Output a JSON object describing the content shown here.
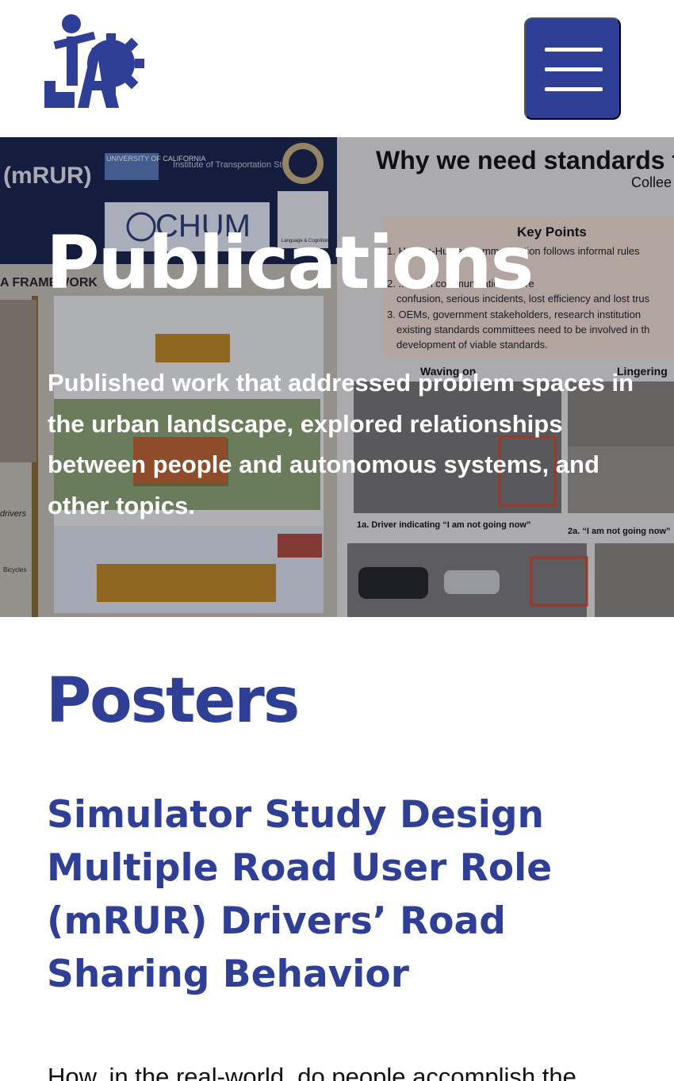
{
  "header": {
    "logo_name": "jap-logo",
    "menu_icon": "hamburger-menu-icon",
    "brand_color": "#2f3f96"
  },
  "hero": {
    "title": "Publications",
    "subtitle": "Published work that addressed problem spaces in the urban landscape, explored relationships between people and autonomous systems, and other topics.",
    "background": {
      "left_poster": {
        "tag": "(mRUR)",
        "univ": "UNIVERSITY OF CALIFORNIA",
        "institute": "Institute of Transportation Studies",
        "chum": "CHUM",
        "lab": "Language & Cognition Lab",
        "framework": "A FRAMEWORK",
        "drivers": "drivers",
        "bicycles": "Bicycles"
      },
      "right_poster": {
        "headline": "Why we need standards f",
        "author": "Collee",
        "key_points_title": "Key Points",
        "points": [
          "1. Human-Human communication follows informal rules",
          "2. ...uman communication will re",
          "confusion, serious incidents, lost efficiency and lost trus",
          "3. OEMs, government stakeholders, research institution",
          "existing standards committees need to be involved in th",
          "development of viable standards."
        ],
        "waving": "Waving on",
        "lingering": "Lingering",
        "caption_1a": "1a. Driver indicating “I am not going now”",
        "caption_2a": "2a. “I am not going now”"
      }
    }
  },
  "content": {
    "section_title": "Posters",
    "poster_title": "Simulator Study Design Multiple Road User Role (mRUR) Drivers’ Road Sharing Behavior",
    "body_text": "How, in the real-world, do people accomplish the"
  }
}
